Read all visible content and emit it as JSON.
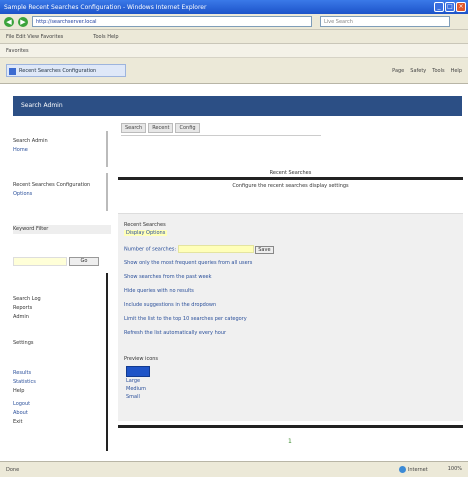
{
  "window": {
    "title": "Sample Recent Searches Configuration - Windows Internet Explorer",
    "min": "_",
    "max": "□",
    "close": "×"
  },
  "address": {
    "back": "◀",
    "forward": "▶",
    "url": "http://searchserver.local",
    "search_placeholder": "Live Search"
  },
  "links_bar": [
    "File  Edit  View  Favorites",
    "Tools  Help"
  ],
  "favorites_bar": "Favorites",
  "tab": {
    "label": "Recent Searches Configuration",
    "tools": [
      "Page",
      "Safety",
      "Tools",
      "Help"
    ]
  },
  "page": {
    "header": "Search Admin",
    "breadcrumbs": [
      "Search",
      "Recent",
      "Config"
    ],
    "sidebar": {
      "block1": [
        "Search Admin",
        "Home"
      ],
      "block2": [
        "Recent Searches Configuration",
        "Options"
      ],
      "field_label": "Keyword Filter",
      "go_label": "Go",
      "block3": [
        "Search Log",
        "Reports",
        "Admin"
      ],
      "block4": "Settings",
      "block5": [
        "Results",
        "Statistics",
        "Help",
        "Logout",
        "About",
        "Exit"
      ]
    },
    "section_title": "Recent Searches",
    "section_sub": "Configure the recent searches display settings",
    "form": {
      "title": "Recent Searches",
      "subtitle": "Display Options",
      "field_label": "Number of searches:",
      "field_button": "Save",
      "lines": [
        "Show only the most frequent queries from all users",
        "Show searches from the past week",
        "Hide queries with no results",
        "Include suggestions in the dropdown",
        "Limit the list to the top 10 searches per category",
        "Refresh the list automatically every hour"
      ],
      "preview_label": "Preview icons",
      "thumbs": [
        "Large",
        "Medium",
        "Small"
      ]
    },
    "page_number": "1"
  },
  "status": {
    "text": "Done",
    "zone": "Internet",
    "zoom": "100%"
  }
}
